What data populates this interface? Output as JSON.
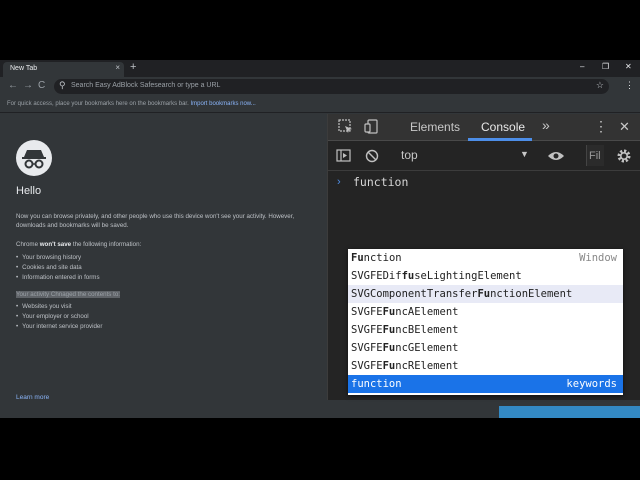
{
  "browser": {
    "tab_title": "New Tab",
    "tab_close": "×",
    "new_tab": "+",
    "win_min": "–",
    "win_max": "❐",
    "win_close": "✕",
    "back": "←",
    "forward": "→",
    "reload": "C",
    "omnibox_placeholder": "Search Easy AdBlock Safesearch or type a URL",
    "star": "☆",
    "menu": "⋮",
    "bookmark_text": "For quick access, place your bookmarks here on the bookmarks bar.",
    "bookmark_link": "Import bookmarks now..."
  },
  "incognito": {
    "heading": "Hello",
    "intro": "Now you can browse privately, and other people who use this device won't see your activity. However, downloads and bookmarks will be saved.",
    "wont_save_pre": "Chrome ",
    "wont_save_bold": "won't save",
    "wont_save_post": " the following information:",
    "wont_save_items": [
      "Your browsing history",
      "Cookies and site data",
      "Information entered in forms"
    ],
    "visible_text": "Your activity Chnaged the contents to:",
    "visible_items": [
      "Websites you visit",
      "Your employer or school",
      "Your internet service provider"
    ],
    "learn_more": "Learn more"
  },
  "devtools": {
    "tabs": [
      "Elements",
      "Console"
    ],
    "more_tabs": "»",
    "menu": "⋮",
    "close": "✕",
    "context": "top",
    "context_arrow": "▼",
    "filter": "Fil",
    "prompt": "›",
    "input": "function",
    "suggestions": [
      {
        "pre": "",
        "bold": "Fu",
        "post": "nction",
        "rhs": "Window"
      },
      {
        "pre": "SVGFEDif",
        "bold": "fu",
        "post": "seLightingElement",
        "rhs": ""
      },
      {
        "pre": "SVGComponentTransfer",
        "bold": "Fu",
        "post": "nctionElement",
        "rhs": ""
      },
      {
        "pre": "SVGFE",
        "bold": "Fu",
        "post": "ncAElement",
        "rhs": ""
      },
      {
        "pre": "SVGFE",
        "bold": "Fu",
        "post": "ncBElement",
        "rhs": ""
      },
      {
        "pre": "SVGFE",
        "bold": "Fu",
        "post": "ncGElement",
        "rhs": ""
      },
      {
        "pre": "SVGFE",
        "bold": "Fu",
        "post": "ncRElement",
        "rhs": ""
      },
      {
        "pre": "",
        "bold": "",
        "post": "function",
        "rhs": "keywords"
      }
    ]
  },
  "taskbar": {
    "items": [
      "start-icon",
      "task-view-icon",
      "edge-icon",
      "file-explorer-icon",
      "store-icon",
      "mail-icon",
      "opera-icon",
      "filezilla-icon",
      "app-icon",
      "powerpoint-icon",
      "chrome-canary-icon",
      "chrome-icon"
    ]
  }
}
